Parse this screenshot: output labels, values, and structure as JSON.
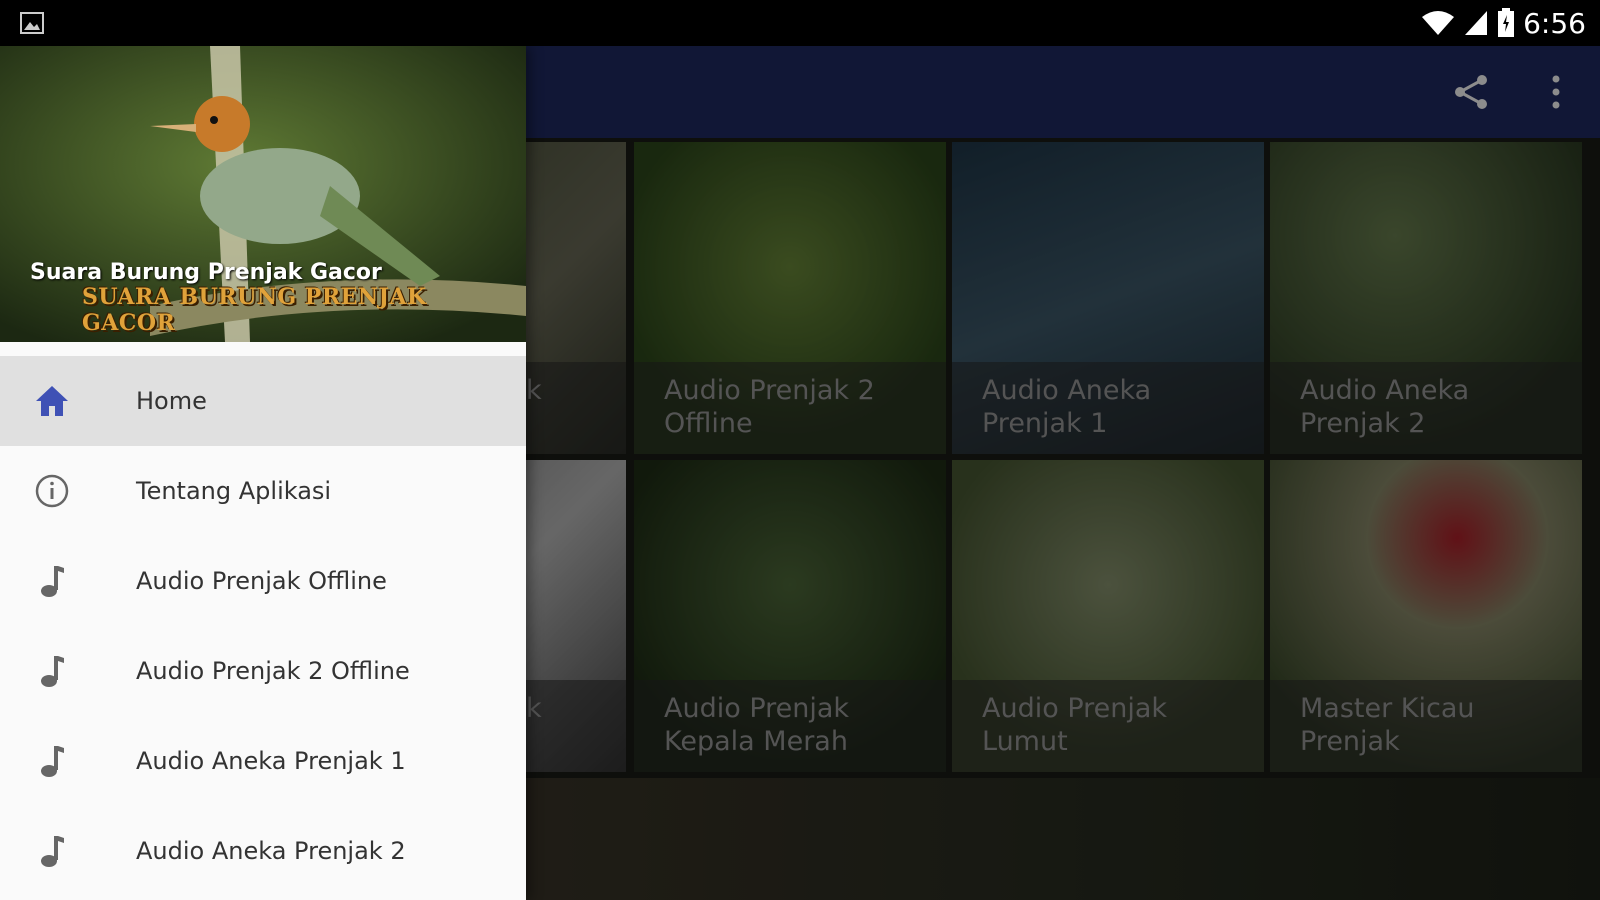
{
  "status_bar": {
    "time": "6:56"
  },
  "drawer": {
    "header_title": "Suara Burung Prenjak Gacor",
    "header_logo_text": "SUARA BURUNG PRENJAK GACOR",
    "items": [
      {
        "label": "Home",
        "icon": "home-icon",
        "active": true
      },
      {
        "label": "Tentang Aplikasi",
        "icon": "info-icon",
        "active": false
      },
      {
        "label": "Audio Prenjak Offline",
        "icon": "music-note-icon",
        "active": false
      },
      {
        "label": "Audio Prenjak 2 Offline",
        "icon": "music-note-icon",
        "active": false
      },
      {
        "label": "Audio Aneka Prenjak 1",
        "icon": "music-note-icon",
        "active": false
      },
      {
        "label": "Audio Aneka Prenjak 2",
        "icon": "music-note-icon",
        "active": false
      }
    ]
  },
  "grid": {
    "tiles": [
      {
        "line1": "k",
        "line2": ""
      },
      {
        "line1": "Audio Prenjak 2",
        "line2": "Offline"
      },
      {
        "line1": "Audio Aneka",
        "line2": "Prenjak 1"
      },
      {
        "line1": "Audio Aneka",
        "line2": "Prenjak 2"
      },
      {
        "line1": "k",
        "line2": ""
      },
      {
        "line1": "Audio Prenjak",
        "line2": "Kepala Merah"
      },
      {
        "line1": "Audio Prenjak",
        "line2": "Lumut"
      },
      {
        "line1": "Master Kicau",
        "line2": "Prenjak"
      }
    ]
  },
  "colors": {
    "app_bar": "#1f2a63",
    "home_icon": "#3f51b5"
  }
}
